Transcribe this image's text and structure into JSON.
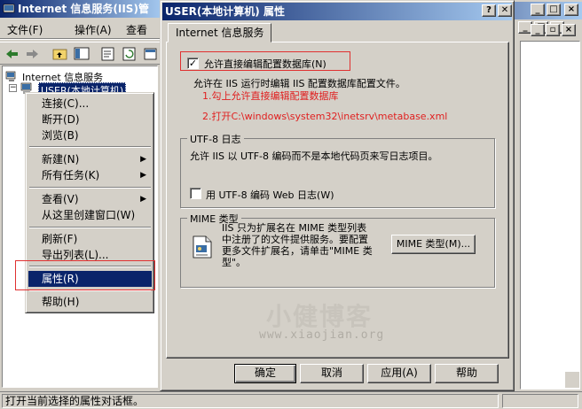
{
  "mmc": {
    "title": "Internet 信息服务(IIS)管",
    "menu": [
      "文件(F)",
      "操作(A)",
      "查看"
    ],
    "tree": {
      "root": "Internet 信息服务",
      "node": "USER(本地计算机)"
    },
    "status": "打开当前选择的属性对话框。"
  },
  "context_menu": {
    "items": [
      {
        "label": "连接(C)...",
        "submenu": false
      },
      {
        "label": "断开(D)",
        "submenu": false
      },
      {
        "label": "浏览(B)",
        "submenu": false
      },
      {
        "label": "新建(N)",
        "submenu": true
      },
      {
        "label": "所有任务(K)",
        "submenu": true
      },
      {
        "label": "查看(V)",
        "submenu": true
      },
      {
        "label": "从这里创建窗口(W)",
        "submenu": false
      },
      {
        "label": "刷新(F)",
        "submenu": false
      },
      {
        "label": "导出列表(L)...",
        "submenu": false
      },
      {
        "label": "属性(R)",
        "submenu": false,
        "selected": true
      },
      {
        "label": "帮助(H)",
        "submenu": false
      }
    ]
  },
  "dialog": {
    "title": "USER(本地计算机) 属性",
    "help_btn": "?",
    "close_btn": "✕",
    "tab": "Internet 信息服务",
    "direct_edit": {
      "label": "允许直接编辑配置数据库(N)",
      "checked": true,
      "description": "允许在 IIS 运行时编辑 IIS 配置数据库配置文件。",
      "note1": "1.勾上允许直接编辑配置数据库",
      "note2": "2.打开C:\\windows\\system32\\inetsrv\\metabase.xml"
    },
    "utf8": {
      "group_label": "UTF-8 日志",
      "description": "允许 IIS 以 UTF-8 编码而不是本地代码页来写日志项目。",
      "checkbox_label": "用 UTF-8 编码 Web 日志(W)",
      "checked": false
    },
    "mime": {
      "group_label": "MIME 类型",
      "description_lines": [
        "IIS 只为扩展名在 MIME 类型列表",
        "中注册了的文件提供服务。要配置",
        "更多文件扩展名，请单击\"MIME 类",
        "型\"。"
      ],
      "button": "MIME 类型(M)..."
    },
    "watermark": {
      "brand": "小健博客",
      "url": "www.xiaojian.org"
    },
    "buttons": {
      "ok": "确定",
      "cancel": "取消",
      "apply": "应用(A)",
      "help": "帮助"
    }
  },
  "colors": {
    "title_active": "#0a246a",
    "menu_selected": "#0a246a",
    "annotation_red": "#e03030"
  }
}
